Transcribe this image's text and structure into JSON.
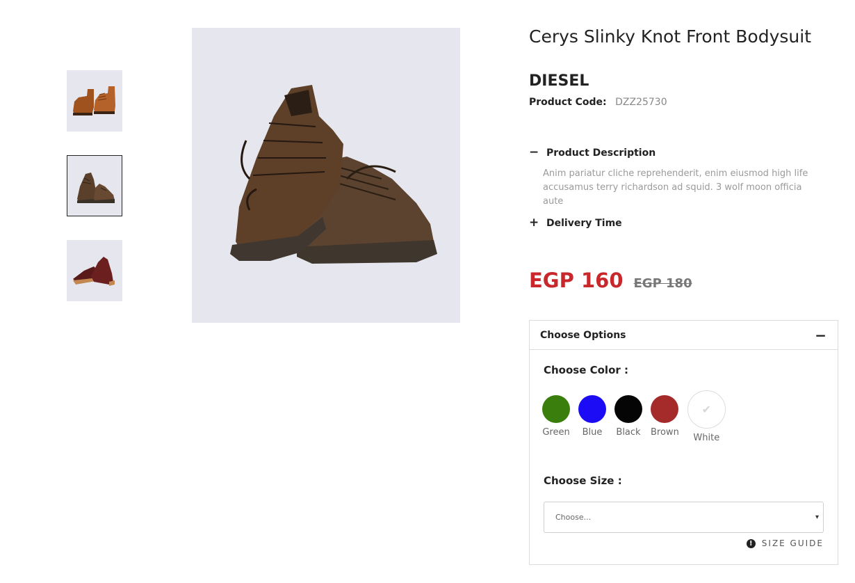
{
  "product": {
    "title": "Cerys Slinky Knot Front Bodysuit",
    "brand": "DIESEL",
    "code_label": "Product Code:",
    "code_value": "DZZ25730"
  },
  "gallery": {
    "thumbnails": [
      {
        "icon": "boots-brown-thumbnail"
      },
      {
        "icon": "hiking-shoes-thumbnail",
        "selected": true
      },
      {
        "icon": "oxford-shoes-thumbnail"
      }
    ],
    "main_image": "hiking-shoes-image"
  },
  "accordion": {
    "description": {
      "sign": "−",
      "label": "Product Description",
      "text": "Anim pariatur cliche reprehenderit, enim eiusmod high life accusamus terry richardson ad squid. 3 wolf moon officia aute"
    },
    "delivery": {
      "sign": "+",
      "label": "Delivery Time"
    }
  },
  "price": {
    "current": "EGP 160",
    "old": "EGP 180",
    "current_color": "#c8282b"
  },
  "options": {
    "title": "Choose Options",
    "toggle": "−",
    "color_label": "Choose Color :",
    "colors": [
      {
        "name": "Green",
        "hex": "#3a7f0d"
      },
      {
        "name": "Blue",
        "hex": "#1b0cf5"
      },
      {
        "name": "Black",
        "hex": "#050505"
      },
      {
        "name": "Brown",
        "hex": "#a52a2a"
      },
      {
        "name": "White",
        "hex": "#ffffff",
        "selected": true
      }
    ],
    "size_label": "Choose Size :",
    "size_placeholder": "Choose...",
    "size_caret": "▾",
    "size_guide": "SIZE GUIDE",
    "size_guide_icon": "!"
  }
}
